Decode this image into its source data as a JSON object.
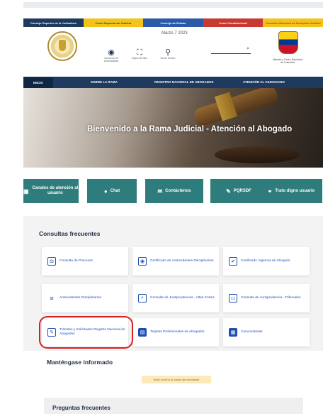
{
  "colorbar": [
    {
      "label": "Consejo Superior de la Judicatura",
      "bg": "#1f3a5f",
      "fg": "#ffffff"
    },
    {
      "label": "Corte Suprema de Justicia",
      "bg": "#f2c318",
      "fg": "#1f3a5f"
    },
    {
      "label": "Consejo de Estado",
      "bg": "#2d5aa8",
      "fg": "#ffffff"
    },
    {
      "label": "Corte Constitucional",
      "bg": "#c63a32",
      "fg": "#ffffff"
    },
    {
      "label": "Comisión Nacional de Disciplina Judicial",
      "bg": "#f2c318",
      "fg": "#c63a32"
    }
  ],
  "header": {
    "date": "Marzo 7 2023",
    "links": [
      {
        "icon": "eye-icon",
        "glyph": "◉",
        "label": "Opciones de Accesibilidad"
      },
      {
        "icon": "sitemap-icon",
        "glyph": "⛶",
        "label": "Mapa del Sitio"
      },
      {
        "icon": "user-icon",
        "glyph": "⚲",
        "label": "Iniciar Sesión"
      }
    ],
    "search_icon": "⌕",
    "seal_right_label": "Libertad y Orden República de Colombia"
  },
  "nav": [
    {
      "label": "INICIO",
      "active": true
    },
    {
      "label": "SOBRE LA RAMA",
      "active": false
    },
    {
      "label": "REGISTRO NACIONAL DE ABOGADOS",
      "active": false
    },
    {
      "label": "ATENCIÓN AL CIUDADANO",
      "active": false
    }
  ],
  "hero": {
    "title": "Bienvenido a la Rama Judicial - Atención al Abogado"
  },
  "quick": [
    {
      "label": "Canales de atención al usuario",
      "icon": "chat-window-icon",
      "glyph": "▣"
    },
    {
      "label": "Chat",
      "icon": "chat-bubble-icon",
      "glyph": "●"
    },
    {
      "label": "Contáctenos",
      "icon": "envelope-icon",
      "glyph": "✉"
    },
    {
      "label": "PQRSDF",
      "icon": "pencil-icon",
      "glyph": "✎"
    },
    {
      "label": "Trato digno usuario",
      "icon": "handshake-icon",
      "glyph": "⚭"
    }
  ],
  "consultas": {
    "title": "Consultas frecuentes",
    "cards": [
      {
        "label": "Consulta de Procesos",
        "icon": "process-icon",
        "glyph": "⚖",
        "style": "box"
      },
      {
        "label": "Certificado de Antecedentes Disciplinarios",
        "icon": "certificate-icon",
        "glyph": "◉",
        "style": "box"
      },
      {
        "label": "Certificado Vigencia de Abogado",
        "icon": "id-card-icon",
        "glyph": "✔",
        "style": "box"
      },
      {
        "label": "Antecedentes Disciplinarios",
        "icon": "checklist-icon",
        "glyph": "≡",
        "style": "plain"
      },
      {
        "label": "Consulta de Jurisprudencias - Altas Cortes",
        "icon": "document-search-icon",
        "glyph": "⌕",
        "style": "box"
      },
      {
        "label": "Consulta de Jurisprudencia - Tribunales",
        "icon": "monitor-icon",
        "glyph": "▭",
        "style": "box"
      },
      {
        "label": "Trámites y Solicitudes Registro Nacional de Abogados",
        "icon": "form-icon",
        "glyph": "✎",
        "style": "box"
      },
      {
        "label": "Tarjetas Profesionales de Abogados",
        "icon": "card-icon",
        "glyph": "▤",
        "style": "fill"
      },
      {
        "label": "Convocatorias",
        "icon": "window-icon",
        "glyph": "▦",
        "style": "fill"
      }
    ]
  },
  "informado": {
    "title": "Manténgase informado",
    "notice": "Hubo un error al cargar las novedades"
  },
  "preguntas": {
    "title": "Preguntas frecuentes"
  }
}
